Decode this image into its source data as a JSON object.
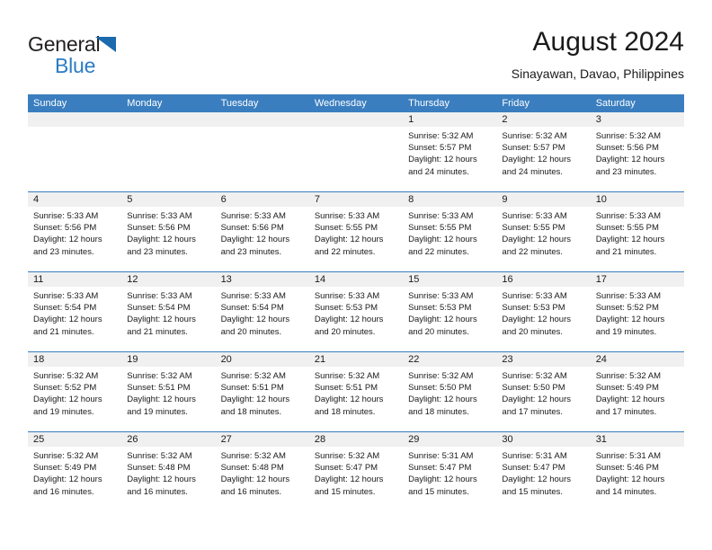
{
  "brand": {
    "word1": "General",
    "word2": "Blue",
    "triangle_color": "#1a6aad",
    "text_color": "#231f20",
    "blue_color": "#2b7cc4"
  },
  "header": {
    "title": "August 2024",
    "location": "Sinayawan, Davao, Philippines"
  },
  "colors": {
    "header_bar": "#3a7ebf",
    "day_band": "#f0f0f0",
    "week_rule": "#3a7ebf"
  },
  "weekdays": [
    "Sunday",
    "Monday",
    "Tuesday",
    "Wednesday",
    "Thursday",
    "Friday",
    "Saturday"
  ],
  "weeks": [
    [
      {
        "day": "",
        "empty": true
      },
      {
        "day": "",
        "empty": true
      },
      {
        "day": "",
        "empty": true
      },
      {
        "day": "",
        "empty": true
      },
      {
        "day": "1",
        "sunrise": "Sunrise: 5:32 AM",
        "sunset": "Sunset: 5:57 PM",
        "daylight": "Daylight: 12 hours and 24 minutes."
      },
      {
        "day": "2",
        "sunrise": "Sunrise: 5:32 AM",
        "sunset": "Sunset: 5:57 PM",
        "daylight": "Daylight: 12 hours and 24 minutes."
      },
      {
        "day": "3",
        "sunrise": "Sunrise: 5:32 AM",
        "sunset": "Sunset: 5:56 PM",
        "daylight": "Daylight: 12 hours and 23 minutes."
      }
    ],
    [
      {
        "day": "4",
        "sunrise": "Sunrise: 5:33 AM",
        "sunset": "Sunset: 5:56 PM",
        "daylight": "Daylight: 12 hours and 23 minutes."
      },
      {
        "day": "5",
        "sunrise": "Sunrise: 5:33 AM",
        "sunset": "Sunset: 5:56 PM",
        "daylight": "Daylight: 12 hours and 23 minutes."
      },
      {
        "day": "6",
        "sunrise": "Sunrise: 5:33 AM",
        "sunset": "Sunset: 5:56 PM",
        "daylight": "Daylight: 12 hours and 23 minutes."
      },
      {
        "day": "7",
        "sunrise": "Sunrise: 5:33 AM",
        "sunset": "Sunset: 5:55 PM",
        "daylight": "Daylight: 12 hours and 22 minutes."
      },
      {
        "day": "8",
        "sunrise": "Sunrise: 5:33 AM",
        "sunset": "Sunset: 5:55 PM",
        "daylight": "Daylight: 12 hours and 22 minutes."
      },
      {
        "day": "9",
        "sunrise": "Sunrise: 5:33 AM",
        "sunset": "Sunset: 5:55 PM",
        "daylight": "Daylight: 12 hours and 22 minutes."
      },
      {
        "day": "10",
        "sunrise": "Sunrise: 5:33 AM",
        "sunset": "Sunset: 5:55 PM",
        "daylight": "Daylight: 12 hours and 21 minutes."
      }
    ],
    [
      {
        "day": "11",
        "sunrise": "Sunrise: 5:33 AM",
        "sunset": "Sunset: 5:54 PM",
        "daylight": "Daylight: 12 hours and 21 minutes."
      },
      {
        "day": "12",
        "sunrise": "Sunrise: 5:33 AM",
        "sunset": "Sunset: 5:54 PM",
        "daylight": "Daylight: 12 hours and 21 minutes."
      },
      {
        "day": "13",
        "sunrise": "Sunrise: 5:33 AM",
        "sunset": "Sunset: 5:54 PM",
        "daylight": "Daylight: 12 hours and 20 minutes."
      },
      {
        "day": "14",
        "sunrise": "Sunrise: 5:33 AM",
        "sunset": "Sunset: 5:53 PM",
        "daylight": "Daylight: 12 hours and 20 minutes."
      },
      {
        "day": "15",
        "sunrise": "Sunrise: 5:33 AM",
        "sunset": "Sunset: 5:53 PM",
        "daylight": "Daylight: 12 hours and 20 minutes."
      },
      {
        "day": "16",
        "sunrise": "Sunrise: 5:33 AM",
        "sunset": "Sunset: 5:53 PM",
        "daylight": "Daylight: 12 hours and 20 minutes."
      },
      {
        "day": "17",
        "sunrise": "Sunrise: 5:33 AM",
        "sunset": "Sunset: 5:52 PM",
        "daylight": "Daylight: 12 hours and 19 minutes."
      }
    ],
    [
      {
        "day": "18",
        "sunrise": "Sunrise: 5:32 AM",
        "sunset": "Sunset: 5:52 PM",
        "daylight": "Daylight: 12 hours and 19 minutes."
      },
      {
        "day": "19",
        "sunrise": "Sunrise: 5:32 AM",
        "sunset": "Sunset: 5:51 PM",
        "daylight": "Daylight: 12 hours and 19 minutes."
      },
      {
        "day": "20",
        "sunrise": "Sunrise: 5:32 AM",
        "sunset": "Sunset: 5:51 PM",
        "daylight": "Daylight: 12 hours and 18 minutes."
      },
      {
        "day": "21",
        "sunrise": "Sunrise: 5:32 AM",
        "sunset": "Sunset: 5:51 PM",
        "daylight": "Daylight: 12 hours and 18 minutes."
      },
      {
        "day": "22",
        "sunrise": "Sunrise: 5:32 AM",
        "sunset": "Sunset: 5:50 PM",
        "daylight": "Daylight: 12 hours and 18 minutes."
      },
      {
        "day": "23",
        "sunrise": "Sunrise: 5:32 AM",
        "sunset": "Sunset: 5:50 PM",
        "daylight": "Daylight: 12 hours and 17 minutes."
      },
      {
        "day": "24",
        "sunrise": "Sunrise: 5:32 AM",
        "sunset": "Sunset: 5:49 PM",
        "daylight": "Daylight: 12 hours and 17 minutes."
      }
    ],
    [
      {
        "day": "25",
        "sunrise": "Sunrise: 5:32 AM",
        "sunset": "Sunset: 5:49 PM",
        "daylight": "Daylight: 12 hours and 16 minutes."
      },
      {
        "day": "26",
        "sunrise": "Sunrise: 5:32 AM",
        "sunset": "Sunset: 5:48 PM",
        "daylight": "Daylight: 12 hours and 16 minutes."
      },
      {
        "day": "27",
        "sunrise": "Sunrise: 5:32 AM",
        "sunset": "Sunset: 5:48 PM",
        "daylight": "Daylight: 12 hours and 16 minutes."
      },
      {
        "day": "28",
        "sunrise": "Sunrise: 5:32 AM",
        "sunset": "Sunset: 5:47 PM",
        "daylight": "Daylight: 12 hours and 15 minutes."
      },
      {
        "day": "29",
        "sunrise": "Sunrise: 5:31 AM",
        "sunset": "Sunset: 5:47 PM",
        "daylight": "Daylight: 12 hours and 15 minutes."
      },
      {
        "day": "30",
        "sunrise": "Sunrise: 5:31 AM",
        "sunset": "Sunset: 5:47 PM",
        "daylight": "Daylight: 12 hours and 15 minutes."
      },
      {
        "day": "31",
        "sunrise": "Sunrise: 5:31 AM",
        "sunset": "Sunset: 5:46 PM",
        "daylight": "Daylight: 12 hours and 14 minutes."
      }
    ]
  ]
}
